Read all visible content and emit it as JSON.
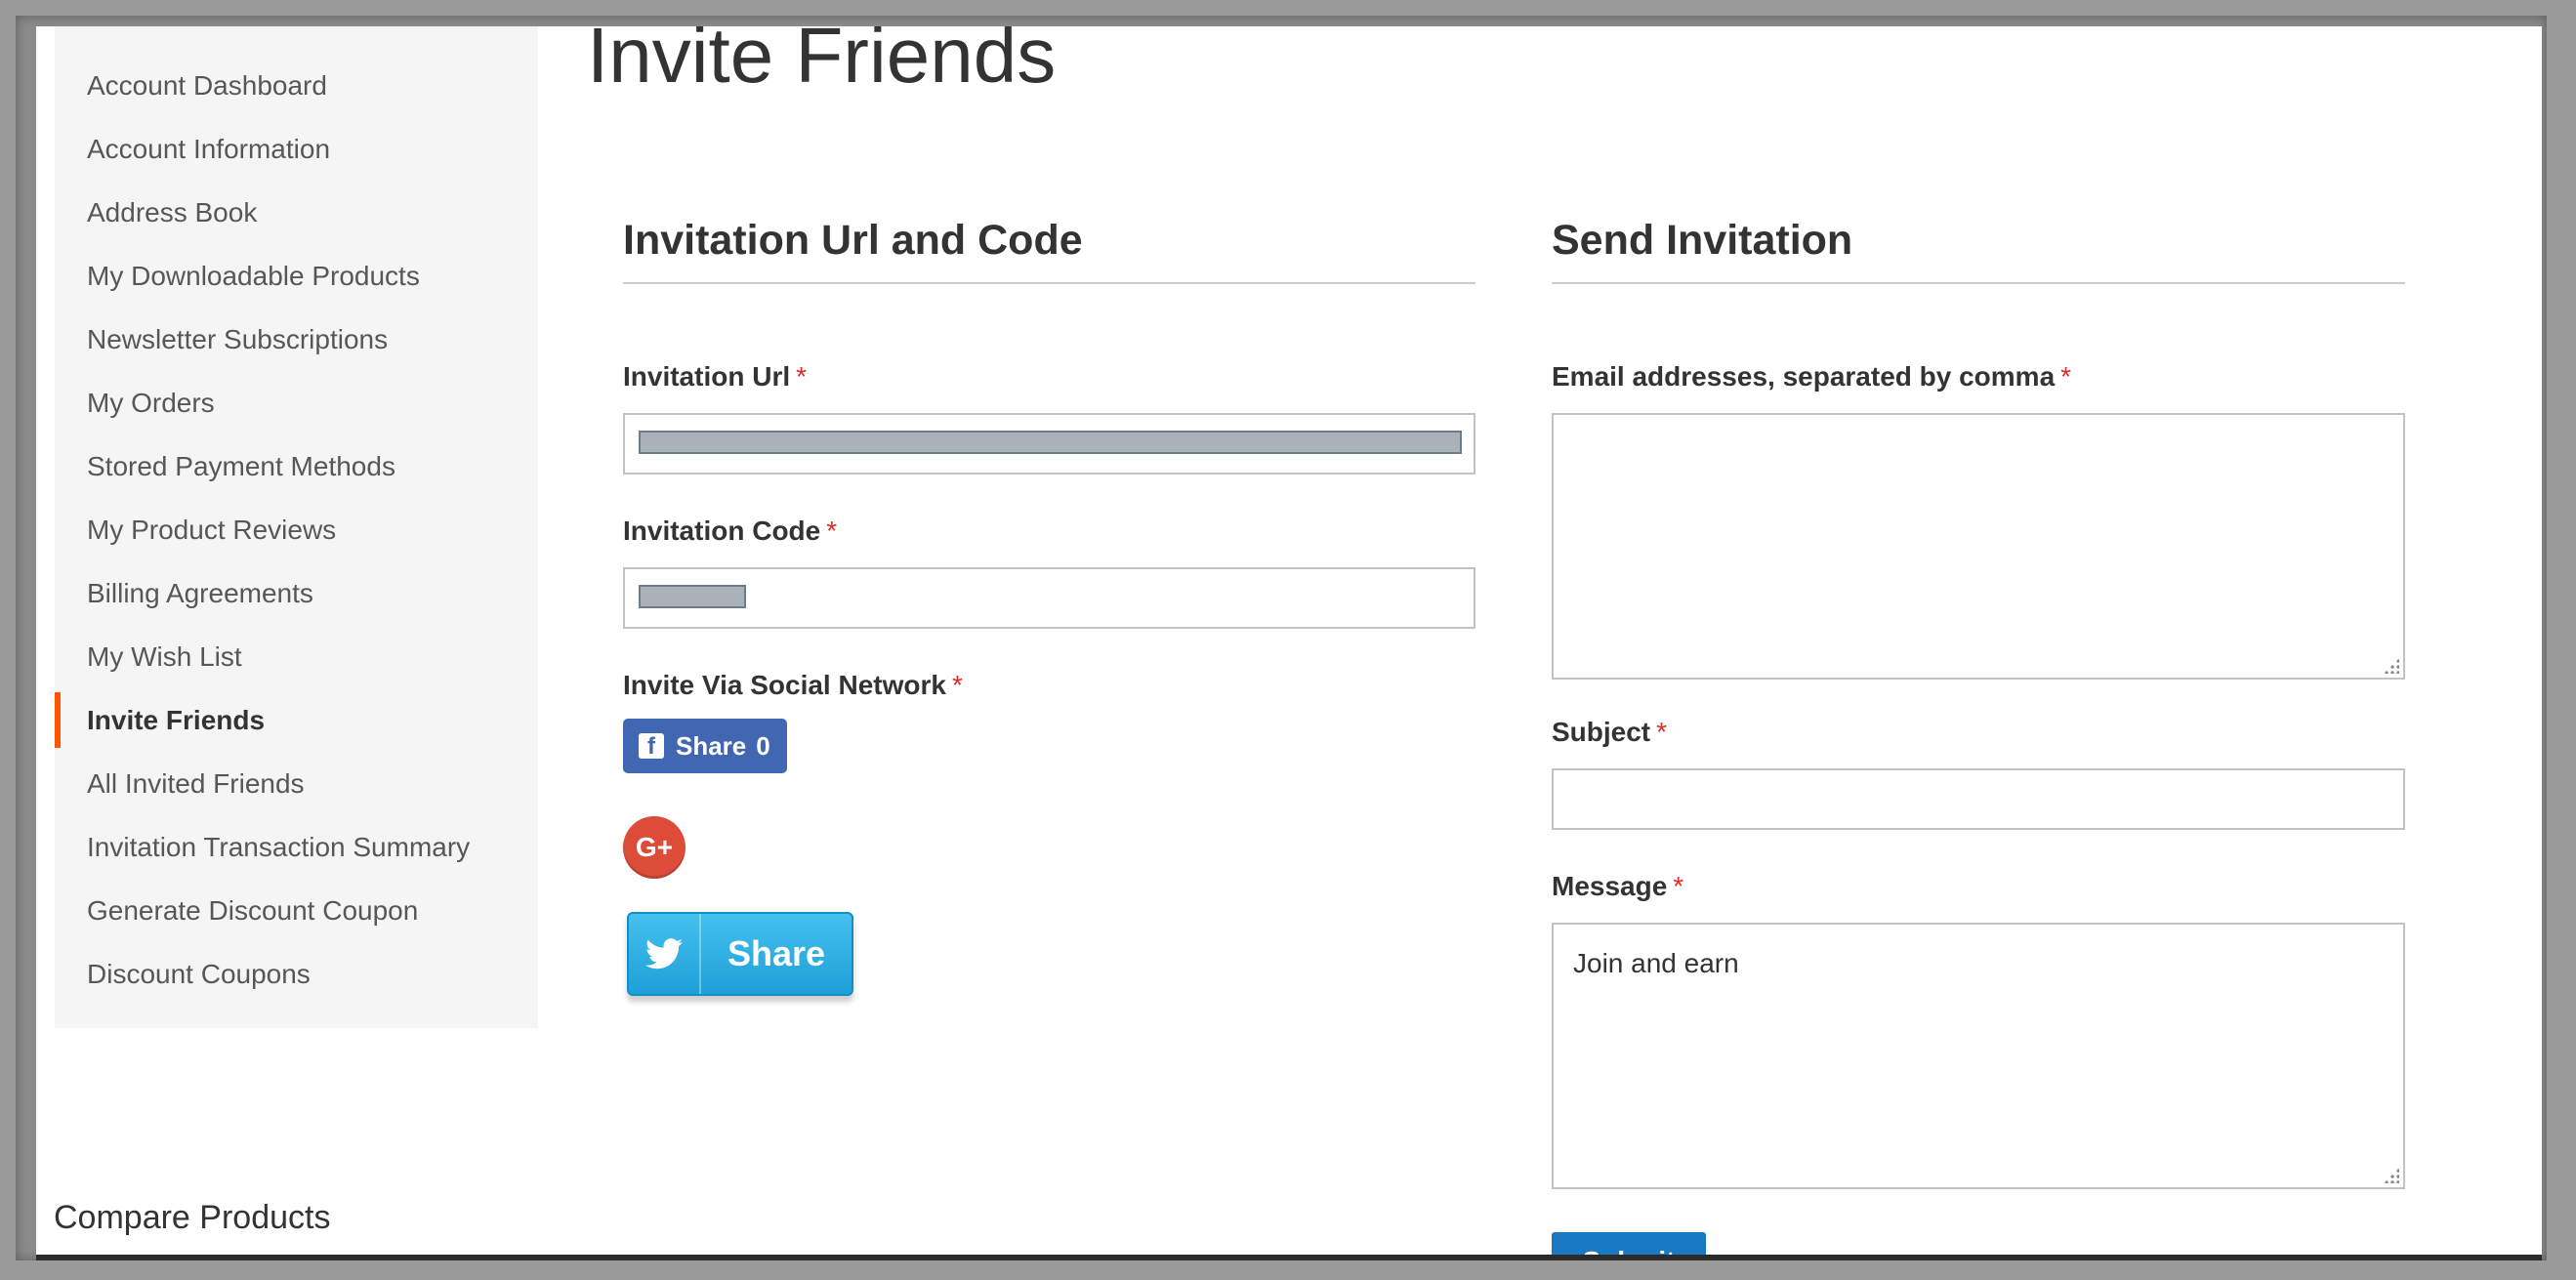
{
  "sidebar": {
    "items": [
      {
        "label": "Account Dashboard"
      },
      {
        "label": "Account Information"
      },
      {
        "label": "Address Book"
      },
      {
        "label": "My Downloadable Products"
      },
      {
        "label": "Newsletter Subscriptions"
      },
      {
        "label": "My Orders"
      },
      {
        "label": "Stored Payment Methods"
      },
      {
        "label": "My Product Reviews"
      },
      {
        "label": "Billing Agreements"
      },
      {
        "label": "My Wish List"
      },
      {
        "label": "Invite Friends",
        "active": true
      },
      {
        "label": "All Invited Friends"
      },
      {
        "label": "Invitation Transaction Summary"
      },
      {
        "label": "Generate Discount Coupon"
      },
      {
        "label": "Discount Coupons"
      }
    ]
  },
  "compare": {
    "title": "Compare Products"
  },
  "page": {
    "title": "Invite Friends"
  },
  "invitation": {
    "heading": "Invitation Url and Code",
    "url_label": "Invitation Url",
    "code_label": "Invitation Code",
    "social_label": "Invite Via Social Network",
    "required_mark": "*",
    "facebook": {
      "label": "Share",
      "count": "0",
      "icon": "facebook-icon",
      "color": "#4267b2"
    },
    "google": {
      "icon": "google-plus-icon",
      "glyph": "G+",
      "color": "#dd4b39"
    },
    "twitter": {
      "label": "Share",
      "icon": "twitter-bird-icon"
    }
  },
  "send": {
    "heading": "Send Invitation",
    "email_label": "Email addresses, separated by comma",
    "email_value": "",
    "subject_label": "Subject",
    "subject_value": "",
    "message_label": "Message",
    "message_value": "Join and earn",
    "submit_label": "Submit"
  },
  "colors": {
    "accent_active": "#ff5501",
    "required": "#e02b27",
    "primary_button": "#1979c3"
  }
}
